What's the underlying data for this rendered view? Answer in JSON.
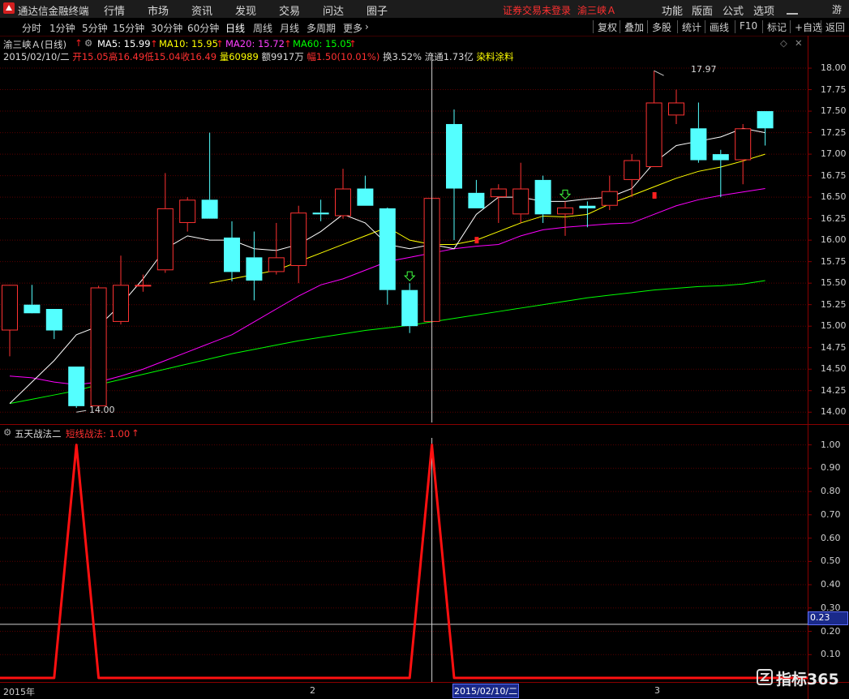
{
  "menubar": {
    "app_title": "通达信金融终端",
    "items": [
      "行情",
      "市场",
      "资讯",
      "发现",
      "交易",
      "问达",
      "圈子"
    ],
    "notice": "证券交易未登录",
    "stock": "渝三峡Ａ",
    "right_items": [
      "功能",
      "版面",
      "公式",
      "选项"
    ],
    "guest": "游客"
  },
  "toolbar": {
    "periods": [
      "分时",
      "1分钟",
      "5分钟",
      "15分钟",
      "30分钟",
      "60分钟",
      "日线",
      "周线",
      "月线",
      "多周期",
      "更多"
    ],
    "active_period": "日线",
    "right_buttons": [
      "复权",
      "叠加",
      "多股",
      "统计",
      "画线",
      "F10",
      "标记",
      "+自选",
      "返回"
    ]
  },
  "chart_header": {
    "title": "渝三峡Ａ(日线)",
    "ma": [
      {
        "name": "MA5",
        "value": "15.99",
        "color": "#ffffff"
      },
      {
        "name": "MA10",
        "value": "15.95",
        "color": "#ffff00"
      },
      {
        "name": "MA20",
        "value": "15.72",
        "color": "#ff00ff"
      },
      {
        "name": "MA60",
        "value": "15.05",
        "color": "#00ff00"
      }
    ],
    "info": {
      "date": "2015/02/10/二",
      "open_label": "开",
      "open": "15.05",
      "high_label": "高",
      "high": "16.49",
      "low_label": "低",
      "low": "15.04",
      "close_label": "收",
      "close": "16.49",
      "vol_label": "量",
      "vol": "60989",
      "amount": "额9917万",
      "range_label": "幅",
      "range": "1.50(10.01%)",
      "turnover": "换3.52%",
      "float": "流通1.73亿",
      "concept": "染料涂料"
    }
  },
  "indicator": {
    "name": "五天战法二",
    "line_label": "短线战法: 1.00",
    "cursor_value": "0.23"
  },
  "price_axis": [
    "18.00",
    "17.75",
    "17.50",
    "17.25",
    "17.00",
    "16.75",
    "16.50",
    "16.25",
    "16.00",
    "15.75",
    "15.50",
    "15.25",
    "15.00",
    "14.75",
    "14.50",
    "14.25",
    "14.00"
  ],
  "indicator_axis": [
    "1.00",
    "0.90",
    "0.80",
    "0.70",
    "0.60",
    "0.50",
    "0.40",
    "0.30",
    "0.20",
    "0.10"
  ],
  "x_axis": [
    "2015年",
    "2",
    "2015/02/10/二",
    "3"
  ],
  "annotations": {
    "high": "17.97",
    "low": "14.00"
  },
  "watermark": "指标365",
  "colors": {
    "up": "#ff3232",
    "down": "#54ffff",
    "indicator": "#ff1010",
    "grid": "#5a0000"
  },
  "chart_data": {
    "type": "candlestick",
    "candles": [
      {
        "o": 14.95,
        "h": 15.45,
        "l": 14.65,
        "c": 15.48
      },
      {
        "o": 15.25,
        "h": 15.48,
        "l": 15.18,
        "c": 15.15
      },
      {
        "o": 15.2,
        "h": 15.2,
        "l": 14.85,
        "c": 14.95
      },
      {
        "o": 14.53,
        "h": 14.53,
        "l": 14.05,
        "c": 14.07
      },
      {
        "o": 14.07,
        "h": 15.47,
        "l": 14.07,
        "c": 15.45
      },
      {
        "o": 15.05,
        "h": 15.82,
        "l": 15.02,
        "c": 15.48
      },
      {
        "o": 15.48,
        "h": 15.6,
        "l": 15.4,
        "c": 15.48
      },
      {
        "o": 15.65,
        "h": 16.78,
        "l": 15.62,
        "c": 16.37
      },
      {
        "o": 16.2,
        "h": 16.5,
        "l": 16.1,
        "c": 16.47
      },
      {
        "o": 16.47,
        "h": 17.25,
        "l": 16.25,
        "c": 16.25
      },
      {
        "o": 16.03,
        "h": 16.22,
        "l": 15.52,
        "c": 15.63
      },
      {
        "o": 15.8,
        "h": 16.1,
        "l": 15.3,
        "c": 15.53
      },
      {
        "o": 15.63,
        "h": 16.2,
        "l": 15.6,
        "c": 15.8
      },
      {
        "o": 15.7,
        "h": 16.4,
        "l": 15.5,
        "c": 16.32
      },
      {
        "o": 16.32,
        "h": 16.47,
        "l": 16.22,
        "c": 16.3
      },
      {
        "o": 16.28,
        "h": 16.83,
        "l": 16.25,
        "c": 16.6
      },
      {
        "o": 16.6,
        "h": 16.75,
        "l": 16.4,
        "c": 16.4
      },
      {
        "o": 16.37,
        "h": 16.38,
        "l": 15.25,
        "c": 15.42
      },
      {
        "o": 15.42,
        "h": 15.5,
        "l": 14.92,
        "c": 15.0
      },
      {
        "o": 15.05,
        "h": 16.49,
        "l": 15.04,
        "c": 16.49
      },
      {
        "o": 17.35,
        "h": 17.52,
        "l": 16.0,
        "c": 16.6
      },
      {
        "o": 16.55,
        "h": 16.7,
        "l": 16.37,
        "c": 16.37
      },
      {
        "o": 16.5,
        "h": 16.65,
        "l": 16.2,
        "c": 16.6
      },
      {
        "o": 16.3,
        "h": 16.9,
        "l": 16.2,
        "c": 16.6
      },
      {
        "o": 16.7,
        "h": 16.75,
        "l": 16.2,
        "c": 16.3
      },
      {
        "o": 16.3,
        "h": 16.45,
        "l": 16.05,
        "c": 16.38
      },
      {
        "o": 16.4,
        "h": 16.45,
        "l": 16.15,
        "c": 16.37
      },
      {
        "o": 16.4,
        "h": 16.75,
        "l": 16.35,
        "c": 16.57
      },
      {
        "o": 16.7,
        "h": 17.0,
        "l": 16.5,
        "c": 16.93
      },
      {
        "o": 16.85,
        "h": 17.97,
        "l": 16.85,
        "c": 17.6
      },
      {
        "o": 17.45,
        "h": 17.75,
        "l": 17.35,
        "c": 17.6
      },
      {
        "o": 17.3,
        "h": 17.6,
        "l": 16.9,
        "c": 16.93
      },
      {
        "o": 17.0,
        "h": 17.05,
        "l": 16.5,
        "c": 16.93
      },
      {
        "o": 16.93,
        "h": 17.35,
        "l": 16.65,
        "c": 17.3
      },
      {
        "o": 17.5,
        "h": 17.5,
        "l": 17.1,
        "c": 17.3
      }
    ],
    "ma5": [
      14.1,
      14.35,
      14.6,
      14.9,
      15.0,
      15.25,
      15.55,
      15.9,
      16.05,
      16.0,
      16.0,
      15.9,
      15.88,
      15.95,
      16.1,
      16.3,
      16.2,
      15.95,
      15.9,
      15.95,
      15.9,
      16.3,
      16.5,
      16.5,
      16.45,
      16.45,
      16.48,
      16.5,
      16.6,
      16.9,
      17.1,
      17.15,
      17.2,
      17.3,
      17.25
    ],
    "ma10": [
      null,
      null,
      null,
      null,
      null,
      null,
      null,
      null,
      null,
      15.5,
      15.55,
      15.6,
      15.65,
      15.75,
      15.85,
      15.95,
      16.05,
      16.15,
      16.0,
      15.95,
      15.95,
      16.0,
      16.1,
      16.2,
      16.28,
      16.27,
      16.3,
      16.42,
      16.52,
      16.62,
      16.72,
      16.8,
      16.85,
      16.92,
      17.0
    ],
    "ma20": [
      14.42,
      14.4,
      14.35,
      14.32,
      14.35,
      14.42,
      14.5,
      14.6,
      14.7,
      14.8,
      14.9,
      15.05,
      15.2,
      15.35,
      15.48,
      15.55,
      15.65,
      15.75,
      15.8,
      15.85,
      15.9,
      15.93,
      15.95,
      16.05,
      16.12,
      16.15,
      16.17,
      16.19,
      16.2,
      16.3,
      16.4,
      16.47,
      16.52,
      16.56,
      16.6
    ],
    "ma60": [
      14.1,
      14.15,
      14.2,
      14.25,
      14.32,
      14.38,
      14.44,
      14.5,
      14.56,
      14.62,
      14.68,
      14.73,
      14.78,
      14.83,
      14.87,
      14.91,
      14.95,
      14.98,
      15.01,
      15.05,
      15.09,
      15.13,
      15.17,
      15.21,
      15.25,
      15.29,
      15.33,
      15.36,
      15.39,
      15.42,
      15.44,
      15.46,
      15.47,
      15.49,
      15.53
    ],
    "signal": [
      0,
      0,
      0,
      1,
      0,
      0,
      0,
      0,
      0,
      0,
      0,
      0,
      0,
      0,
      0,
      0,
      0,
      0,
      0,
      1,
      0,
      0,
      0,
      0,
      0,
      0,
      0,
      0,
      0,
      0,
      0,
      0,
      0,
      0,
      0
    ],
    "ylim": [
      13.88,
      18.17
    ],
    "indicator_ylim": [
      0,
      1.03
    ],
    "cursor_index": 19
  }
}
